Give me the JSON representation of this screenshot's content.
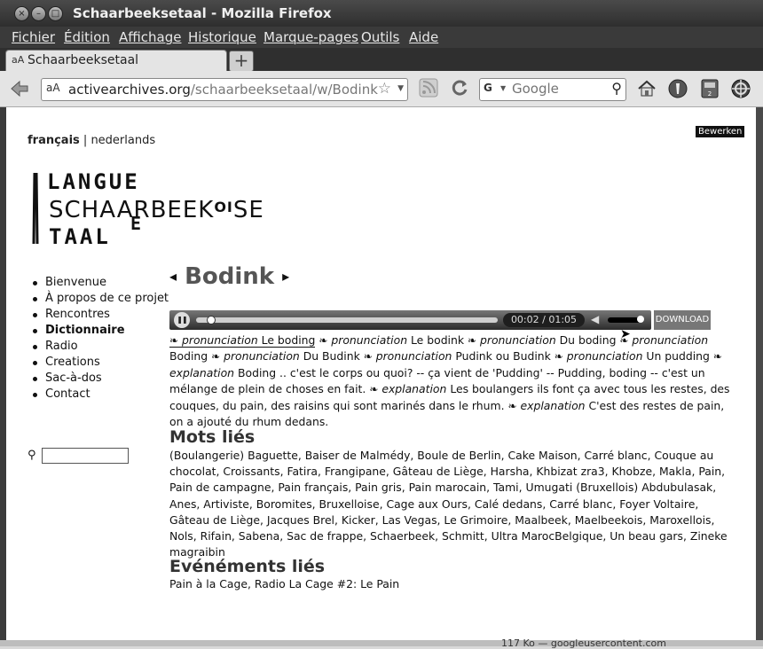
{
  "window": {
    "title": "Schaarbeeksetaal - Mozilla Firefox",
    "controls": [
      "×",
      "–",
      "□"
    ]
  },
  "menubar": {
    "items": [
      "Fichier",
      "Édition",
      "Affichage",
      "Historique",
      "Marque-pages",
      "Outils",
      "Aide"
    ]
  },
  "tab": {
    "favicon": "aA",
    "label": "Schaarbeeksetaal",
    "new_tab_icon": "+"
  },
  "navbar": {
    "site_identity": "aA",
    "url_host": "activearchives.org",
    "url_path": "/schaarbeeksetaal/w/Bodink",
    "search_engine": "G",
    "search_placeholder": "Google"
  },
  "page": {
    "lang_fr": "français",
    "lang_sep": " | ",
    "lang_nl": "nederlands",
    "edit_label": "Bewerken",
    "logo": {
      "line1": "LANGUE",
      "line2": "SCHA",
      "line2b": "ARBEEK",
      "line2c": "OI",
      "line2d": "SE",
      "line3": "TAAL"
    },
    "sidebar": [
      {
        "label": "Bienvenue",
        "active": false
      },
      {
        "label": "À propos de ce projet",
        "active": false
      },
      {
        "label": "Rencontres",
        "active": false
      },
      {
        "label": "Dictionnaire",
        "active": true
      },
      {
        "label": "Radio",
        "active": false
      },
      {
        "label": "Creations",
        "active": false
      },
      {
        "label": "Sac-à-dos",
        "active": false
      },
      {
        "label": "Contact",
        "active": false
      }
    ],
    "heading": "Bodink",
    "prev_arrow": "◂",
    "next_arrow": "▸",
    "player": {
      "current_time": "00:02",
      "total_time": "01:05",
      "progress": 0.03,
      "volume": 0.9,
      "download_label": "DOWNLOAD"
    },
    "pronunciation": {
      "fleur": "❧",
      "p_label": "pronunciation",
      "e_label": "explanation",
      "p1": "Le boding",
      "p2": "Le bodink",
      "p3": "Du boding",
      "p4": "Boding",
      "p5": "Du Budink",
      "p6": "Pudink ou Budink",
      "p7": "Un pudding",
      "e1": "Boding .. c'est le corps ou quoi? -- ça vient de 'Pudding' -- Pudding, boding -- c'est un mélange de plein de choses en fait.",
      "e2": "Les boulangers ils font ça avec tous les restes, des couques, du pain, des raisins qui sont marinés dans le rhum.",
      "e3": "C'est des restes de pain, on a ajouté du rhum dedans."
    },
    "related_words_title": "Mots liés",
    "related_words": "(Boulangerie) Baguette, Baiser de Malmédy, Boule de Berlin, Cake Maison, Carré blanc, Couque au chocolat, Croissants, Fatira, Frangipane, Gâteau de Liège, Harsha, Khbizat zra3, Khobze, Makla, Pain, Pain de campagne, Pain français, Pain gris, Pain marocain, Tami, Umugati (Bruxellois) Abdubulasak, Anes, Artiviste, Boromites, Bruxelloise, Cage aux Ours, Calé dedans, Carré blanc, Foyer Voltaire, Gâteau de Liège, Jacques Brel, Kicker, Las Vegas, Le Grimoire, Maalbeek, Maelbeekois, Maroxellois, Nols, Rifain, Sabena, Sac de frappe, Schaerbeek, Schmitt, Ultra MarocBelgique, Un beau gars, Zineke magraibin",
    "related_events_title": "Evénéments liés",
    "related_events": "Pain à la Cage, Radio La Cage #2: Le Pain"
  },
  "status": {
    "partial_text": "117 Ko — googleusercontent.com"
  }
}
